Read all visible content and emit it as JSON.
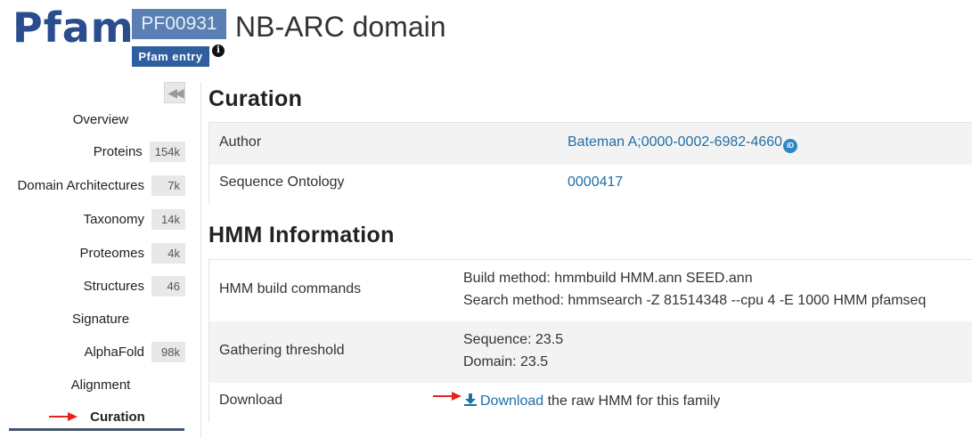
{
  "header": {
    "logo_text": "Pfam",
    "accession": "PF00931",
    "entry_type": "Pfam entry",
    "title": "NB-ARC domain",
    "info_icon": "info-icon"
  },
  "sidebar": {
    "collapse_icon": "double-chevron-left-icon",
    "items": [
      {
        "label": "Overview",
        "count": null
      },
      {
        "label": "Proteins",
        "count": "154k"
      },
      {
        "label": "Domain Architectures",
        "count": "7k"
      },
      {
        "label": "Taxonomy",
        "count": "14k"
      },
      {
        "label": "Proteomes",
        "count": "4k"
      },
      {
        "label": "Structures",
        "count": "46"
      },
      {
        "label": "Signature",
        "count": null
      },
      {
        "label": "AlphaFold",
        "count": "98k"
      },
      {
        "label": "Alignment",
        "count": null
      },
      {
        "label": "Curation",
        "count": null,
        "active": true
      }
    ]
  },
  "curation": {
    "title": "Curation",
    "author_label": "Author",
    "author_value": "Bateman A;0000-0002-6982-4660",
    "orcid_icon": "orcid-icon",
    "ontology_label": "Sequence Ontology",
    "ontology_value": "0000417"
  },
  "hmm": {
    "title": "HMM Information",
    "build_label": "HMM build commands",
    "build_method": "Build method: hmmbuild HMM.ann SEED.ann",
    "search_method": "Search method: hmmsearch -Z 81514348 --cpu 4 -E 1000 HMM pfamseq",
    "threshold_label": "Gathering threshold",
    "sequence_threshold": "Sequence: 23.5",
    "domain_threshold": "Domain: 23.5",
    "download_label": "Download",
    "download_link": "Download",
    "download_suffix": " the raw HMM for this family",
    "download_icon": "download-icon"
  },
  "colors": {
    "brand": "#2a4d8f",
    "link": "#1f6fa8",
    "annotation_arrow": "#e8231b"
  }
}
